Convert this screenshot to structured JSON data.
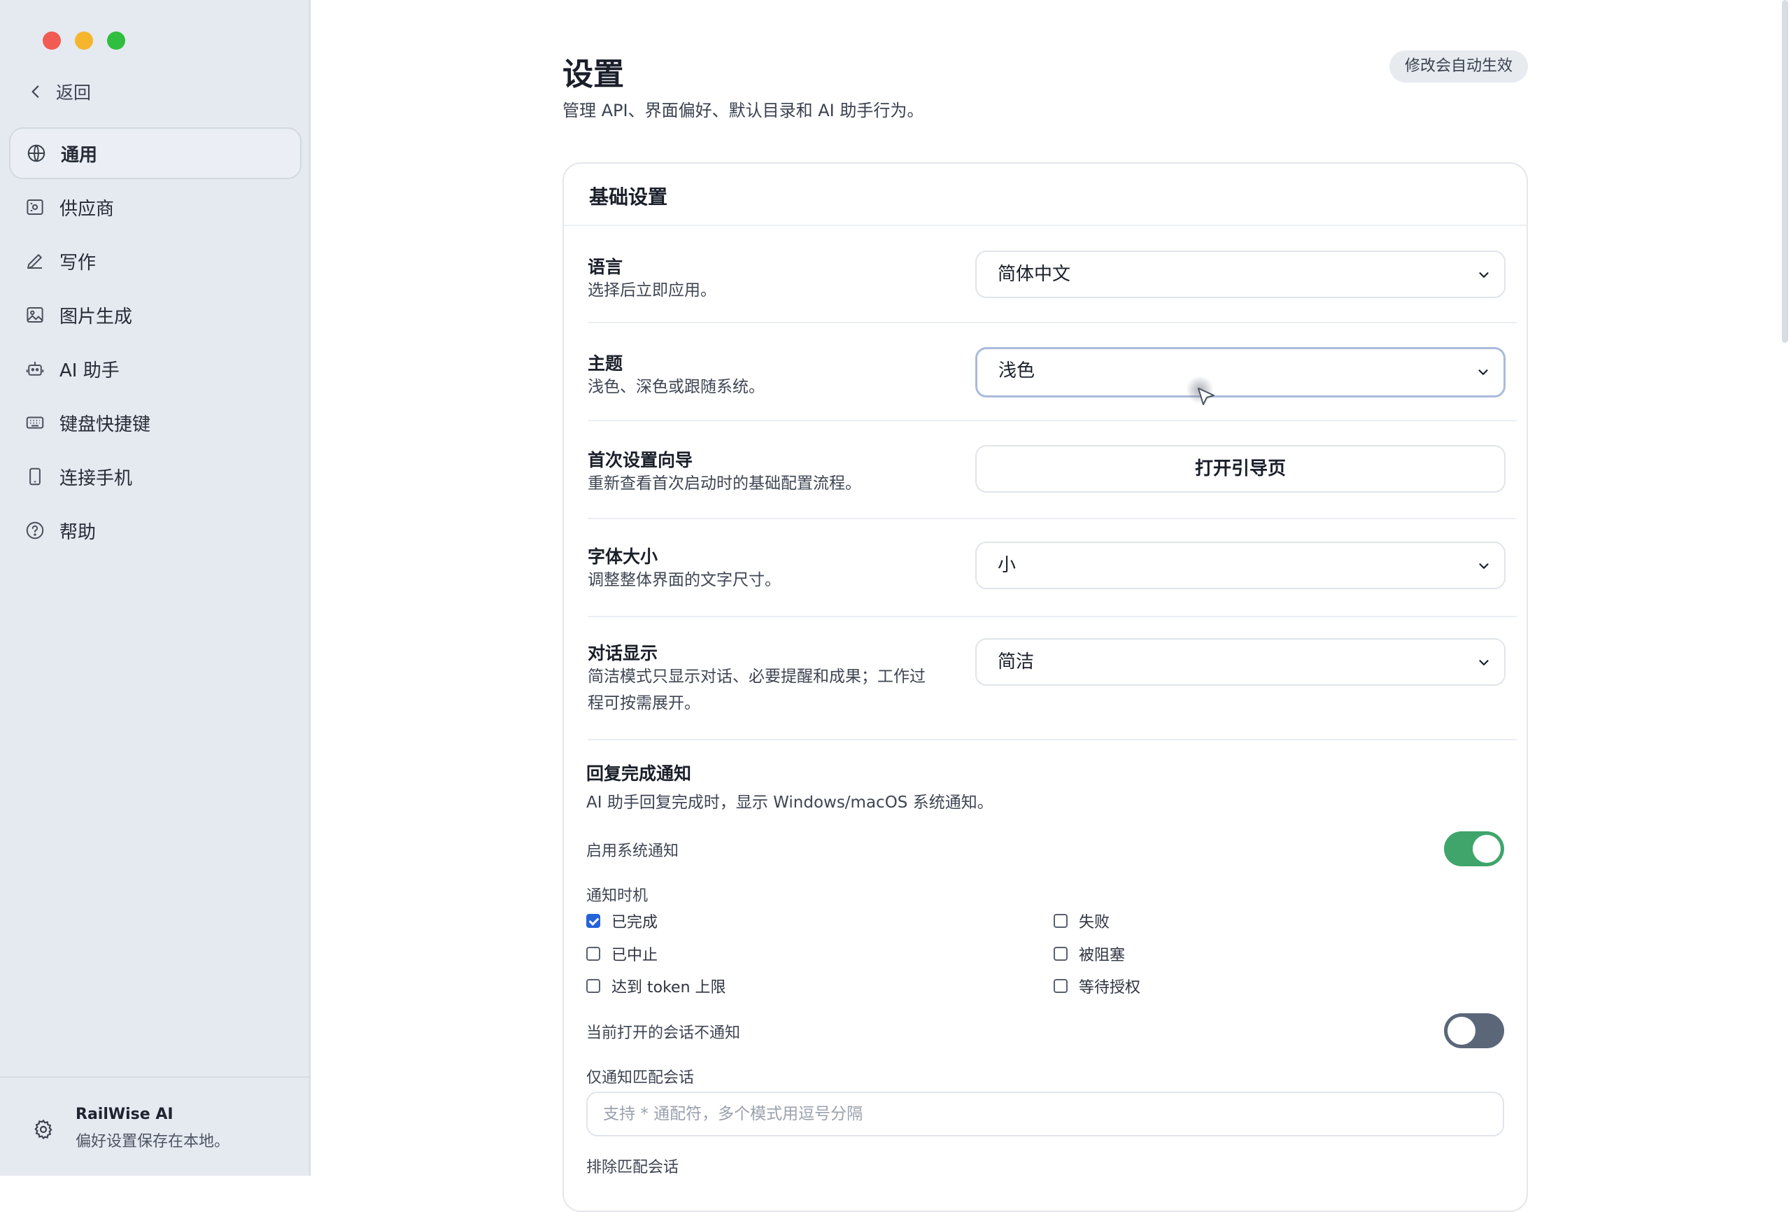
{
  "window": {
    "traffic_lights": [
      "close",
      "minimize",
      "maximize"
    ],
    "colors": {
      "close": "#f15b51",
      "minimize": "#f5b52d",
      "maximize": "#2fbe3d"
    }
  },
  "sidebar": {
    "back_label": "返回",
    "items": [
      {
        "label": "通用",
        "icon": "globe-icon",
        "active": true
      },
      {
        "label": "供应商",
        "icon": "provider-icon",
        "active": false
      },
      {
        "label": "写作",
        "icon": "pencil-icon",
        "active": false
      },
      {
        "label": "图片生成",
        "icon": "image-icon",
        "active": false
      },
      {
        "label": "AI 助手",
        "icon": "robot-icon",
        "active": false
      },
      {
        "label": "键盘快捷键",
        "icon": "keyboard-icon",
        "active": false
      },
      {
        "label": "连接手机",
        "icon": "phone-icon",
        "active": false
      },
      {
        "label": "帮助",
        "icon": "help-icon",
        "active": false
      }
    ],
    "footer": {
      "title": "RailWise AI",
      "subtitle": "偏好设置保存在本地。",
      "icon": "gear-icon"
    }
  },
  "header": {
    "title": "设置",
    "subtitle": "管理 API、界面偏好、默认目录和 AI 助手行为。",
    "badge": "修改会自动生效"
  },
  "card": {
    "title": "基础设置",
    "rows": [
      {
        "label": "语言",
        "desc": "选择后立即应用。",
        "control": "select",
        "value": "简体中文"
      },
      {
        "label": "主题",
        "desc": "浅色、深色或跟随系统。",
        "control": "select",
        "value": "浅色",
        "focused": true
      },
      {
        "label": "首次设置向导",
        "desc": "重新查看首次启动时的基础配置流程。",
        "control": "button",
        "value": "打开引导页"
      },
      {
        "label": "字体大小",
        "desc": "调整整体界面的文字尺寸。",
        "control": "select",
        "value": "小"
      },
      {
        "label": "对话显示",
        "desc": "简洁模式只显示对话、必要提醒和成果；工作过程可按需展开。",
        "desc_lines": [
          "简洁模式只显示对话、必要提醒和成果；工作过",
          "程可按需展开。"
        ],
        "control": "select",
        "value": "简洁"
      }
    ],
    "notify": {
      "title": "回复完成通知",
      "desc": "AI 助手回复完成时，显示 Windows/macOS 系统通知。",
      "enable_label": "启用系统通知",
      "enable_on": true,
      "timing_label": "通知时机",
      "options": [
        {
          "label": "已完成",
          "checked": true
        },
        {
          "label": "失败",
          "checked": false
        },
        {
          "label": "已中止",
          "checked": false
        },
        {
          "label": "被阻塞",
          "checked": false
        },
        {
          "label": "达到 token 上限",
          "checked": false
        },
        {
          "label": "等待授权",
          "checked": false
        }
      ],
      "suppress_label": "当前打开的会话不通知",
      "suppress_on": false,
      "match_label": "仅通知匹配会话",
      "match_placeholder": "支持 * 通配符，多个模式用逗号分隔",
      "exclude_label": "排除匹配会话"
    }
  },
  "colors": {
    "accent_green": "#3fa56b",
    "toggle_off": "#5b6779",
    "checkbox_blue": "#2563d9"
  }
}
